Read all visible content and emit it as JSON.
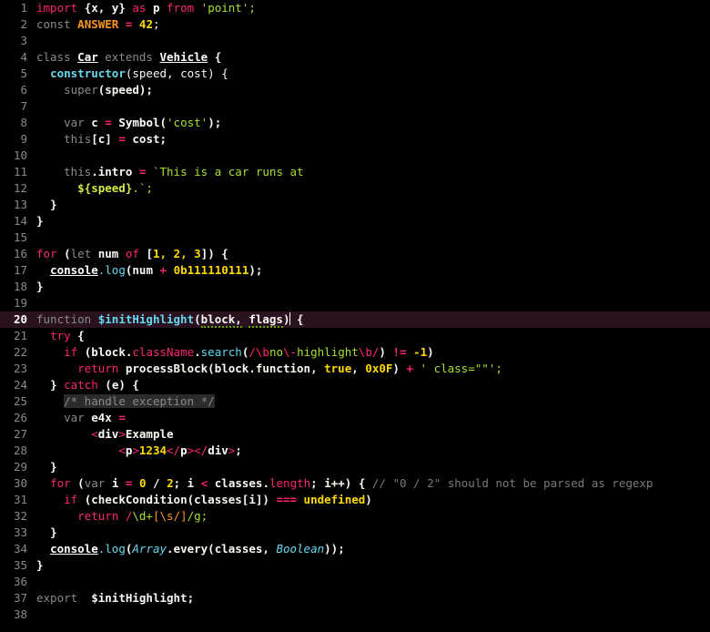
{
  "editor": {
    "language": "JavaScript",
    "background_color": "#000000",
    "active_line_number": 20,
    "active_line_background": "#2b1220",
    "gutter_color": "#8a8a8a",
    "total_lines": 38,
    "palette": {
      "keyword": "#f92672",
      "keyword_dim": "#8a8a8a",
      "function": "#66d9ef",
      "string": "#a6e22e",
      "number": "#ffd900",
      "constant": "#fd971f",
      "comment": "#7a7a7a",
      "title": "#ffffff",
      "foreground": "#f8f8f2",
      "spell_squiggle": "#5ea500"
    },
    "line_numbers": [
      "1",
      "2",
      "3",
      "4",
      "5",
      "6",
      "7",
      "8",
      "9",
      "10",
      "11",
      "12",
      "13",
      "14",
      "15",
      "16",
      "17",
      "18",
      "19",
      "20",
      "21",
      "22",
      "23",
      "24",
      "25",
      "26",
      "27",
      "28",
      "29",
      "30",
      "31",
      "32",
      "33",
      "34",
      "35",
      "36",
      "37",
      "38"
    ],
    "lines": [
      {
        "n": "1",
        "text": "import {x, y} as p from 'point';"
      },
      {
        "n": "2",
        "text": "const ANSWER = 42;"
      },
      {
        "n": "3",
        "text": ""
      },
      {
        "n": "4",
        "text": "class Car extends Vehicle {"
      },
      {
        "n": "5",
        "text": "  constructor(speed, cost) {"
      },
      {
        "n": "6",
        "text": "    super(speed);"
      },
      {
        "n": "7",
        "text": ""
      },
      {
        "n": "8",
        "text": "    var c = Symbol('cost');"
      },
      {
        "n": "9",
        "text": "    this[c] = cost;"
      },
      {
        "n": "10",
        "text": ""
      },
      {
        "n": "11",
        "text": "    this.intro = `This is a car runs at"
      },
      {
        "n": "12",
        "text": "      ${speed}.`;"
      },
      {
        "n": "13",
        "text": "  }"
      },
      {
        "n": "14",
        "text": "}"
      },
      {
        "n": "15",
        "text": ""
      },
      {
        "n": "16",
        "text": "for (let num of [1, 2, 3]) {"
      },
      {
        "n": "17",
        "text": "  console.log(num + 0b111110111);"
      },
      {
        "n": "18",
        "text": "}"
      },
      {
        "n": "19",
        "text": ""
      },
      {
        "n": "20",
        "text": "function $initHighlight(block, flags) {"
      },
      {
        "n": "21",
        "text": "  try {"
      },
      {
        "n": "22",
        "text": "    if (block.className.search(/\\bno\\-highlight\\b/) != -1)"
      },
      {
        "n": "23",
        "text": "      return processBlock(block.function, true, 0x0F) + ' class=\"\"';"
      },
      {
        "n": "24",
        "text": "  } catch (e) {"
      },
      {
        "n": "25",
        "text": "    /* handle exception */"
      },
      {
        "n": "26",
        "text": "    var e4x ="
      },
      {
        "n": "27",
        "text": "        <div>Example"
      },
      {
        "n": "28",
        "text": "            <p>1234</p></div>;"
      },
      {
        "n": "29",
        "text": "  }"
      },
      {
        "n": "30",
        "text": "  for (var i = 0 / 2; i < classes.length; i++) { // \"0 / 2\" should not be parsed as regexp"
      },
      {
        "n": "31",
        "text": "    if (checkCondition(classes[i]) === undefined)"
      },
      {
        "n": "32",
        "text": "      return /\\d+[\\s/]/g;"
      },
      {
        "n": "33",
        "text": "  }"
      },
      {
        "n": "34",
        "text": "  console.log(Array.every(classes, Boolean));"
      },
      {
        "n": "35",
        "text": "}"
      },
      {
        "n": "36",
        "text": ""
      },
      {
        "n": "37",
        "text": "export  $initHighlight;"
      },
      {
        "n": "38",
        "text": ""
      }
    ],
    "tokens": {
      "import": "import",
      "as": "as",
      "from": "from",
      "point_string": "'point';",
      "braces_xy": "{x, y}",
      "p": "p",
      "const": "const",
      "ANSWER": "ANSWER",
      "eq": "=",
      "num42": "42",
      "semi": ";",
      "class": "class",
      "Car": "Car",
      "extends": "extends",
      "Vehicle": "Vehicle",
      "brace_open": "{",
      "brace_close": "}",
      "constructor": "constructor",
      "params_speed_cost": "(speed, cost) {",
      "super": "super",
      "speed_paren": "(speed);",
      "var": "var",
      "c": "c",
      "Symbol": "Symbol",
      "cost_string": "'cost'",
      "this": "this",
      "bracket_c": "[c]",
      "cost": "cost;",
      "intro": "intro",
      "template_head": "`This is a car runs at",
      "template_sub": "${speed}",
      "template_tail": ".`;",
      "for": "for",
      "let": "let",
      "num": "num",
      "of": "of",
      "array123": "1, 2, 3",
      "console": "console",
      "log": ".log",
      "binary": "0b111110111",
      "plus": "+",
      "function": "function",
      "initHighlight": "$initHighlight",
      "block": "block,",
      "flags": "flags",
      "try": "try",
      "if": "if",
      "block_dot": "block.",
      "className": "className",
      "search": "search",
      "regex_open": "/",
      "regex_b1": "\\b",
      "regex_body": "no",
      "regex_esc": "\\-",
      "regex_body2": "highlight",
      "regex_b2": "\\b",
      "regex_close": "/",
      "neq": "!=",
      "minus1": "-1",
      "return": "return",
      "processBlock": "processBlock(block.",
      "fn_prop": "function",
      "true": "true",
      "hex": "0x0F",
      "class_attr": "' class=\"\"';",
      "catch": "catch",
      "e": "(e) {",
      "comment_handle": "/* handle exception */",
      "e4x": "e4x",
      "tag_div_open": "div",
      "tag_example": "Example",
      "tag_p": "p",
      "num1234": "1234",
      "i": "i",
      "zero": "0",
      "slash": "/",
      "two": "2",
      "classes": "classes.",
      "length": "length",
      "incr": "i++",
      "comment_regexp": "// \"0 / 2\" should not be parsed as regexp",
      "checkCondition": "checkCondition(classes[i])",
      "tripleeq": "===",
      "undefined": "undefined",
      "regex2_d": "\\d+",
      "regex2_cls": "[\\s/]",
      "regex2_flag": "/g;",
      "Array": "Array",
      "every": ".every(classes, ",
      "Boolean": "Boolean",
      "close_pp": "));",
      "export": "export"
    }
  }
}
